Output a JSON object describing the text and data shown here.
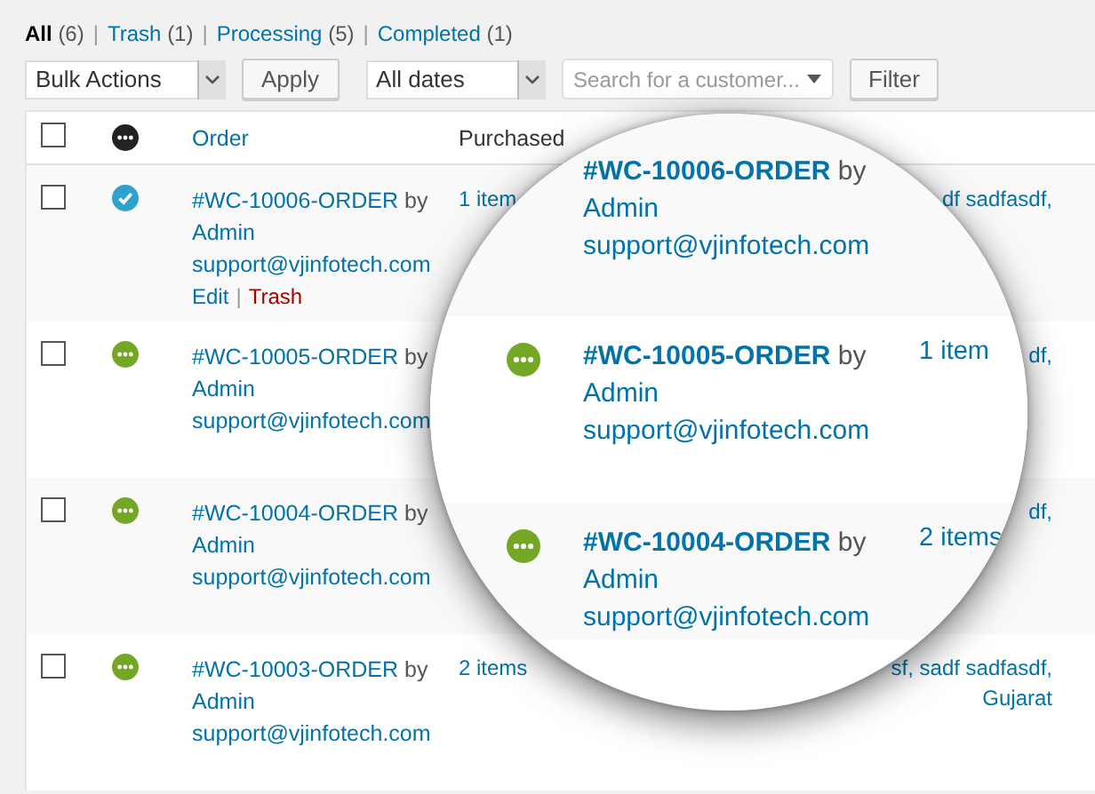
{
  "filters": [
    {
      "label": "All",
      "count": "(6)",
      "selected": true
    },
    {
      "label": "Trash",
      "count": "(1)",
      "selected": false
    },
    {
      "label": "Processing",
      "count": "(5)",
      "selected": false
    },
    {
      "label": "Completed",
      "count": "(1)",
      "selected": false
    }
  ],
  "separator": "|",
  "toolbar": {
    "bulk_actions": "Bulk Actions",
    "apply": "Apply",
    "dates": "All dates",
    "search": {
      "placeholder": "Search for a customer..."
    },
    "filter": "Filter"
  },
  "table": {
    "header": {
      "checked": false,
      "order": "Order",
      "purchased": "Purchased"
    },
    "rows": [
      {
        "checked": false,
        "completed": true,
        "order": "#WC-10006-ORDER",
        "by": "by",
        "name": "Admin",
        "email": "support@vjinfotech.com",
        "actions": [
          {
            "label": "Edit",
            "kind": "edit"
          },
          {
            "label": "Trash",
            "kind": "trash"
          }
        ],
        "purchased": "1 item",
        "ship_to": [
          "df sadfasdf,"
        ]
      },
      {
        "checked": false,
        "completed": false,
        "order": "#WC-10005-ORDER",
        "by": "by",
        "name": "Admin",
        "email": "support@vjinfotech.com",
        "ship_to": [
          "df,"
        ]
      },
      {
        "checked": false,
        "completed": false,
        "order": "#WC-10004-ORDER",
        "by": "by",
        "name": "Admin",
        "email": "support@vjinfotech.com",
        "ship_to": [
          "df,"
        ]
      },
      {
        "checked": false,
        "completed": false,
        "order": "#WC-10003-ORDER",
        "by": "by",
        "name": "Admin",
        "email": "support@vjinfotech.com",
        "purchased": "2 items",
        "ship_to": [
          "sf, sadf sadfasdf,",
          "Gujarat"
        ]
      }
    ]
  },
  "magnifier": {
    "rows": [
      {
        "order": "#WC-10006-ORDER",
        "by": "by",
        "name": "Admin",
        "email": "support@vjinfotech.com"
      },
      {
        "completed": false,
        "order": "#WC-10005-ORDER",
        "by": "by",
        "name": "Admin",
        "email": "support@vjinfotech.com",
        "purchased": "1 item"
      },
      {
        "completed": false,
        "order": "#WC-10004-ORDER",
        "by": "by",
        "name": "Admin",
        "email": "support@vjinfotech.com",
        "purchased": "2 items"
      }
    ]
  }
}
